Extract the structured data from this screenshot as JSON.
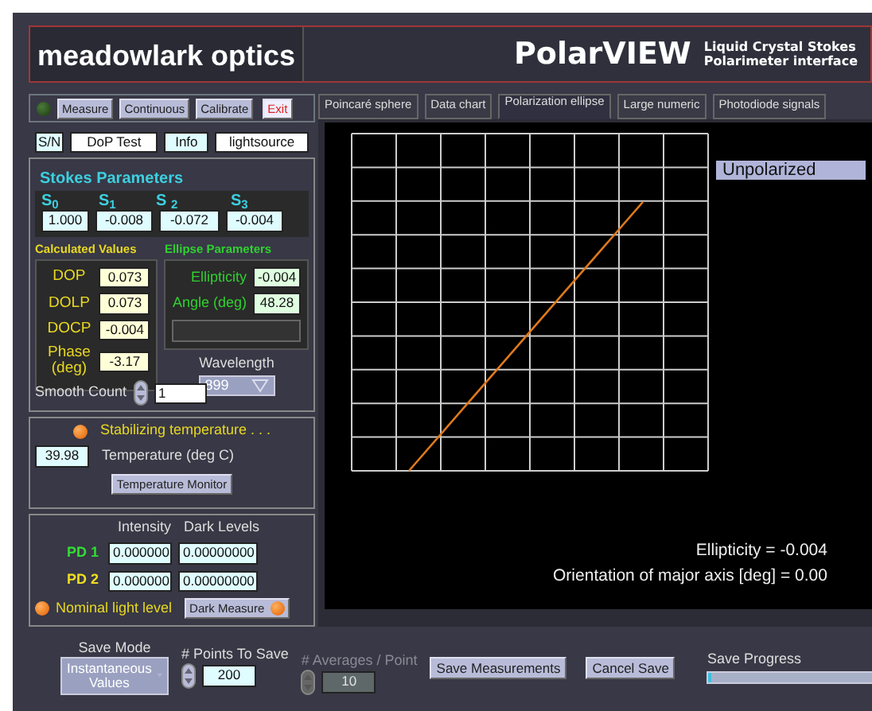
{
  "header": {
    "logo": "meadowlark optics",
    "title": "PolarVIEW",
    "subtitle": [
      "Liquid Crystal Stokes",
      "Polarimeter interface"
    ]
  },
  "controls": {
    "run_led": {
      "on": false
    },
    "buttons": [
      {
        "label": "Measure",
        "kind": "normal"
      },
      {
        "label": "Continuous",
        "kind": "normal"
      },
      {
        "label": "Calibrate",
        "kind": "normal"
      },
      {
        "label": "Exit",
        "kind": "danger"
      }
    ]
  },
  "info_row": {
    "sn_label": "S/N",
    "sn_value": "DoP Test",
    "info_label": "Info",
    "info_value": "lightsource"
  },
  "stokes": {
    "title": "Stokes Parameters",
    "params": [
      {
        "label": "S$_{0}$",
        "value": "1.000"
      },
      {
        "label": "S$_{1}$",
        "value": "-0.008"
      },
      {
        "label": "S $_{2}$",
        "value": "-0.072"
      },
      {
        "label": "S$_{3}$",
        "value": "-0.004"
      }
    ]
  },
  "calculated": {
    "title": "Calculated Values",
    "rows": [
      {
        "label": "DOP",
        "value": "0.073"
      },
      {
        "label": "DOLP",
        "value": "0.073"
      },
      {
        "label": "DOCP",
        "value": "-0.004"
      },
      {
        "label": "Phase (deg)",
        "value": "-3.17"
      }
    ]
  },
  "ellipse": {
    "title": "Ellipse Parameters",
    "rows": [
      {
        "label": "Ellipticity",
        "value": "-0.004"
      },
      {
        "label": "Angle (deg)",
        "value": "48.28"
      }
    ]
  },
  "smooth_count": {
    "label": "Smooth Count",
    "value": "1"
  },
  "wavelength": {
    "label": "Wavelength",
    "value": "899"
  },
  "temperature": {
    "led": {
      "on": true
    },
    "status": "Stabilizing temperature . . .",
    "value": "39.98",
    "label": "Temperature (deg C)",
    "button": "Temperature Monitor"
  },
  "photodiodes": {
    "columns": [
      "Intensity",
      "Dark Levels"
    ],
    "rows": [
      {
        "label": "PD 1",
        "color": "#33dd33",
        "intensity": "0.000000",
        "dark": "0.00000000"
      },
      {
        "label": "PD 2",
        "color": "#eedd22",
        "intensity": "0.000000",
        "dark": "0.00000000"
      }
    ],
    "light_led": {
      "on": true
    },
    "light_label": "Nominal light level",
    "dark_button": "Dark Measure",
    "dark_led": {
      "on": true
    }
  },
  "tabs": [
    {
      "label": "Poincaré sphere",
      "selected": false
    },
    {
      "label": "Data chart",
      "selected": false
    },
    {
      "label": "Polarization ellipse",
      "selected": true
    },
    {
      "label": "Large numeric",
      "selected": false
    },
    {
      "label": "Photodiode signals",
      "selected": false
    }
  ],
  "plot": {
    "status": "Unpolarized",
    "ellipticity": "Ellipticity = -0.004",
    "orientation": "Orientation of major axis [deg] = 0.00"
  },
  "save": {
    "mode_label": "Save Mode",
    "mode_value": "Instantaneous Values",
    "points_label": "# Points To Save",
    "points_value": "200",
    "averages_label": "# Averages / Point",
    "averages_value": "10",
    "averages_disabled": true,
    "save_button": "Save Measurements",
    "cancel_button": "Cancel Save",
    "progress_label": "Save Progress",
    "level": 0.01
  }
}
